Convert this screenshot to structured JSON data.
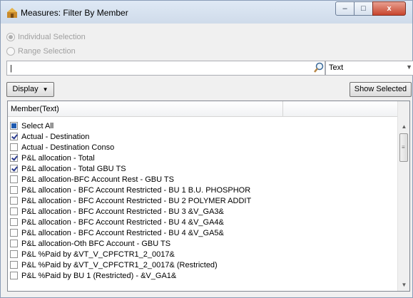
{
  "window": {
    "title": "Measures: Filter By Member",
    "controls": {
      "minimize": "–",
      "maximize": "□",
      "close": "x"
    }
  },
  "selection_mode": {
    "options": [
      {
        "label": "Individual Selection",
        "checked": true,
        "enabled": false
      },
      {
        "label": "Range Selection",
        "checked": false,
        "enabled": false
      }
    ]
  },
  "search": {
    "value": "|",
    "type_value": "Text"
  },
  "toolbar": {
    "display_label": "Display",
    "show_selected_label": "Show Selected"
  },
  "grid": {
    "column_header": "Member(Text)",
    "rows": [
      {
        "label": "Select All",
        "state": "partial"
      },
      {
        "label": "Actual - Destination",
        "state": "checked"
      },
      {
        "label": "Actual - Destination Conso",
        "state": "unchecked"
      },
      {
        "label": "P&L allocation - Total",
        "state": "checked"
      },
      {
        "label": "P&L allocation - Total GBU TS",
        "state": "checked"
      },
      {
        "label": "P&L allocation-BFC Account Rest - GBU TS",
        "state": "unchecked"
      },
      {
        "label": "P&L allocation - BFC Account Restricted - BU 1 B.U. PHOSPHOR",
        "state": "unchecked"
      },
      {
        "label": "P&L allocation - BFC Account Restricted - BU 2 POLYMER ADDIT",
        "state": "unchecked"
      },
      {
        "label": "P&L allocation - BFC Account Restricted - BU 3 &V_GA3&",
        "state": "unchecked"
      },
      {
        "label": "P&L allocation - BFC Account Restricted - BU 4 &V_GA4&",
        "state": "unchecked"
      },
      {
        "label": "P&L allocation - BFC Account Restricted - BU 4 &V_GA5&",
        "state": "unchecked"
      },
      {
        "label": "P&L allocation-Oth BFC Account - GBU TS",
        "state": "unchecked"
      },
      {
        "label": "P&L %Paid by &VT_V_CPFCTR1_2_0017&",
        "state": "unchecked"
      },
      {
        "label": "P&L %Paid by &VT_V_CPFCTR1_2_0017& (Restricted)",
        "state": "unchecked"
      },
      {
        "label": "P&L %Paid by BU 1 (Restricted) - &V_GA1&",
        "state": "unchecked"
      }
    ]
  },
  "colors": {
    "selection_blue": "#1e5ab0",
    "close_red": "#c8452e"
  }
}
